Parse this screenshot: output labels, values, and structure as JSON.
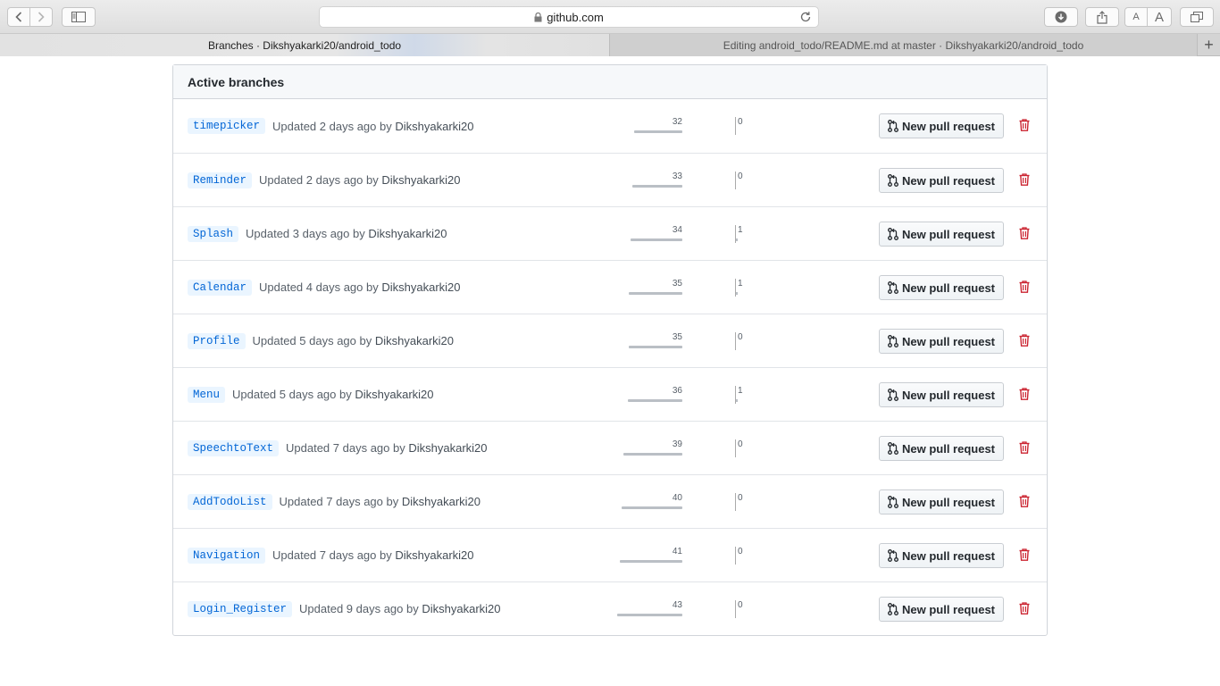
{
  "browser": {
    "url": "github.com",
    "tabs": [
      {
        "title": "Branches · Dikshyakarki20/android_todo",
        "active": true
      },
      {
        "title": "Editing android_todo/README.md at master · Dikshyakarki20/android_todo",
        "active": false
      }
    ],
    "reader_small": "A",
    "reader_large": "A",
    "new_tab": "+"
  },
  "page": {
    "section_title": "Active branches",
    "pr_label": "New pull request",
    "accent": "#0366d6",
    "danger": "#cb2431"
  },
  "branches": [
    {
      "name": "timepicker",
      "updated": "Updated 2 days ago by",
      "author": "Dikshyakarki20",
      "behind": 32,
      "ahead": 0
    },
    {
      "name": "Reminder",
      "updated": "Updated 2 days ago by",
      "author": "Dikshyakarki20",
      "behind": 33,
      "ahead": 0
    },
    {
      "name": "Splash",
      "updated": "Updated 3 days ago by",
      "author": "Dikshyakarki20",
      "behind": 34,
      "ahead": 1
    },
    {
      "name": "Calendar",
      "updated": "Updated 4 days ago by",
      "author": "Dikshyakarki20",
      "behind": 35,
      "ahead": 1
    },
    {
      "name": "Profile",
      "updated": "Updated 5 days ago by",
      "author": "Dikshyakarki20",
      "behind": 35,
      "ahead": 0
    },
    {
      "name": "Menu",
      "updated": "Updated 5 days ago by",
      "author": "Dikshyakarki20",
      "behind": 36,
      "ahead": 1
    },
    {
      "name": "SpeechtoText",
      "updated": "Updated 7 days ago by",
      "author": "Dikshyakarki20",
      "behind": 39,
      "ahead": 0
    },
    {
      "name": "AddTodoList",
      "updated": "Updated 7 days ago by",
      "author": "Dikshyakarki20",
      "behind": 40,
      "ahead": 0
    },
    {
      "name": "Navigation",
      "updated": "Updated 7 days ago by",
      "author": "Dikshyakarki20",
      "behind": 41,
      "ahead": 0
    },
    {
      "name": "Login_Register",
      "updated": "Updated 9 days ago by",
      "author": "Dikshyakarki20",
      "behind": 43,
      "ahead": 0
    }
  ]
}
